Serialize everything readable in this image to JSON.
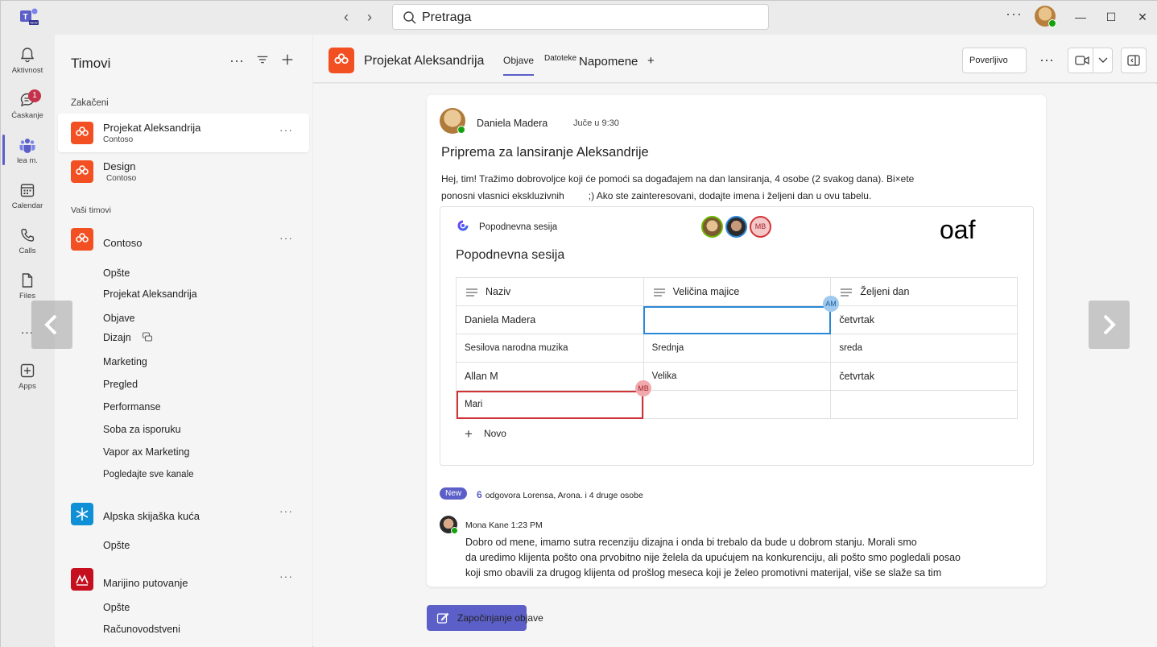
{
  "search": {
    "placeholder": "Pretraga"
  },
  "rail": {
    "items": [
      {
        "label": "Aktivnost",
        "icon": "bell-icon"
      },
      {
        "label": "Ćaskanje",
        "icon": "chat-icon",
        "badge": "1"
      },
      {
        "label": "lea m.",
        "icon": "teams-icon"
      },
      {
        "label": "Calendar",
        "icon": "calendar-icon"
      },
      {
        "label": "Calls",
        "icon": "phone-icon"
      },
      {
        "label": "Files",
        "icon": "file-icon"
      },
      {
        "label": "...",
        "icon": "more-icon"
      },
      {
        "label": "Apps",
        "icon": "apps-icon"
      }
    ]
  },
  "teams_panel": {
    "title": "Timovi",
    "pinned_label": "Zakačeni",
    "your_teams_label": "Vaši timovi",
    "pinned": [
      {
        "name": "Projekat Aleksandrija",
        "org": "Contoso"
      },
      {
        "name": "Design",
        "org": "Contoso"
      }
    ],
    "teams": [
      {
        "name": "Contoso",
        "channels": [
          "Opšte",
          "Projekat Aleksandrija",
          "Objave",
          "Dizajn",
          "Marketing",
          "Pregled",
          "Performanse",
          "Soba za isporuku",
          "Vapor ax Marketing",
          "Pogledajte sve kanale"
        ]
      },
      {
        "name": "Alpska skijaška kuća",
        "channels": [
          "Opšte"
        ]
      },
      {
        "name": "Marijino putovanje",
        "channels": [
          "Opšte",
          "Računovodstveni"
        ]
      }
    ]
  },
  "header": {
    "title": "Projekat Aleksandrija",
    "tabs": [
      "Objave",
      "Datoteke",
      "Napomene",
      "+"
    ],
    "confidential_label": "Poverljivo"
  },
  "post": {
    "author": "Daniela Madera",
    "time": "Juče u 9:30",
    "title": "Priprema za lansiranje Aleksandrije",
    "body_line1": "Hej, tim! Tražimo dobrovoljce koji će pomoći sa događajem na dan lansiranja, 4 osobe (2 svakog dana). Bi×ete",
    "body_line2": "ponosni vlasnici ekskluzivnih         ;) Ako ste zainteresovani, dodajte imena i željeni dan u ovu tabelu.",
    "loop": {
      "label": "Popodnevna sesija",
      "handwritten": "oaf",
      "title": "Popodnevna sesija",
      "collaborators": [
        "",
        "",
        "MB"
      ],
      "columns": [
        "Naziv",
        "Veličina majice",
        "Željeni dan"
      ],
      "rows": [
        [
          "Daniela Madera",
          "",
          "četvrtak"
        ],
        [
          "Sesilova narodna muzika",
          "Srednja",
          "sreda"
        ],
        [
          "Allan M",
          "Velika",
          "četvrtak"
        ],
        [
          "Mari",
          "",
          ""
        ]
      ],
      "cursor_tags": [
        "AM",
        "MB"
      ],
      "add_label": "Novo"
    },
    "new_pill": "New",
    "reply_count": "6",
    "reply_summary": "odgovora Lorensa, Arona. i 4 druge osobe",
    "reply": {
      "author_time": "Mona Kane 1:23 PM",
      "line1": "Dobro od mene, imamo sutra recenziju dizajna i onda bi trebalo da bude u dobrom stanju. Morali smo",
      "line2": "da uredimo klijenta pošto ona prvobitno nije želela da upućujem na konkurenciju, ali pošto smo pogledali posao",
      "line3": "koji smo obavili za drugog klijenta od prošlog meseca koji je želeo promotivni materijal, više se slaže sa tim"
    }
  },
  "compose": {
    "start_label": "Započinjanje objave"
  },
  "colors": {
    "accent": "#5b5fc7",
    "team_orange": "#f25022",
    "presence_green": "#13a10e",
    "badge_red": "#c4314b"
  }
}
